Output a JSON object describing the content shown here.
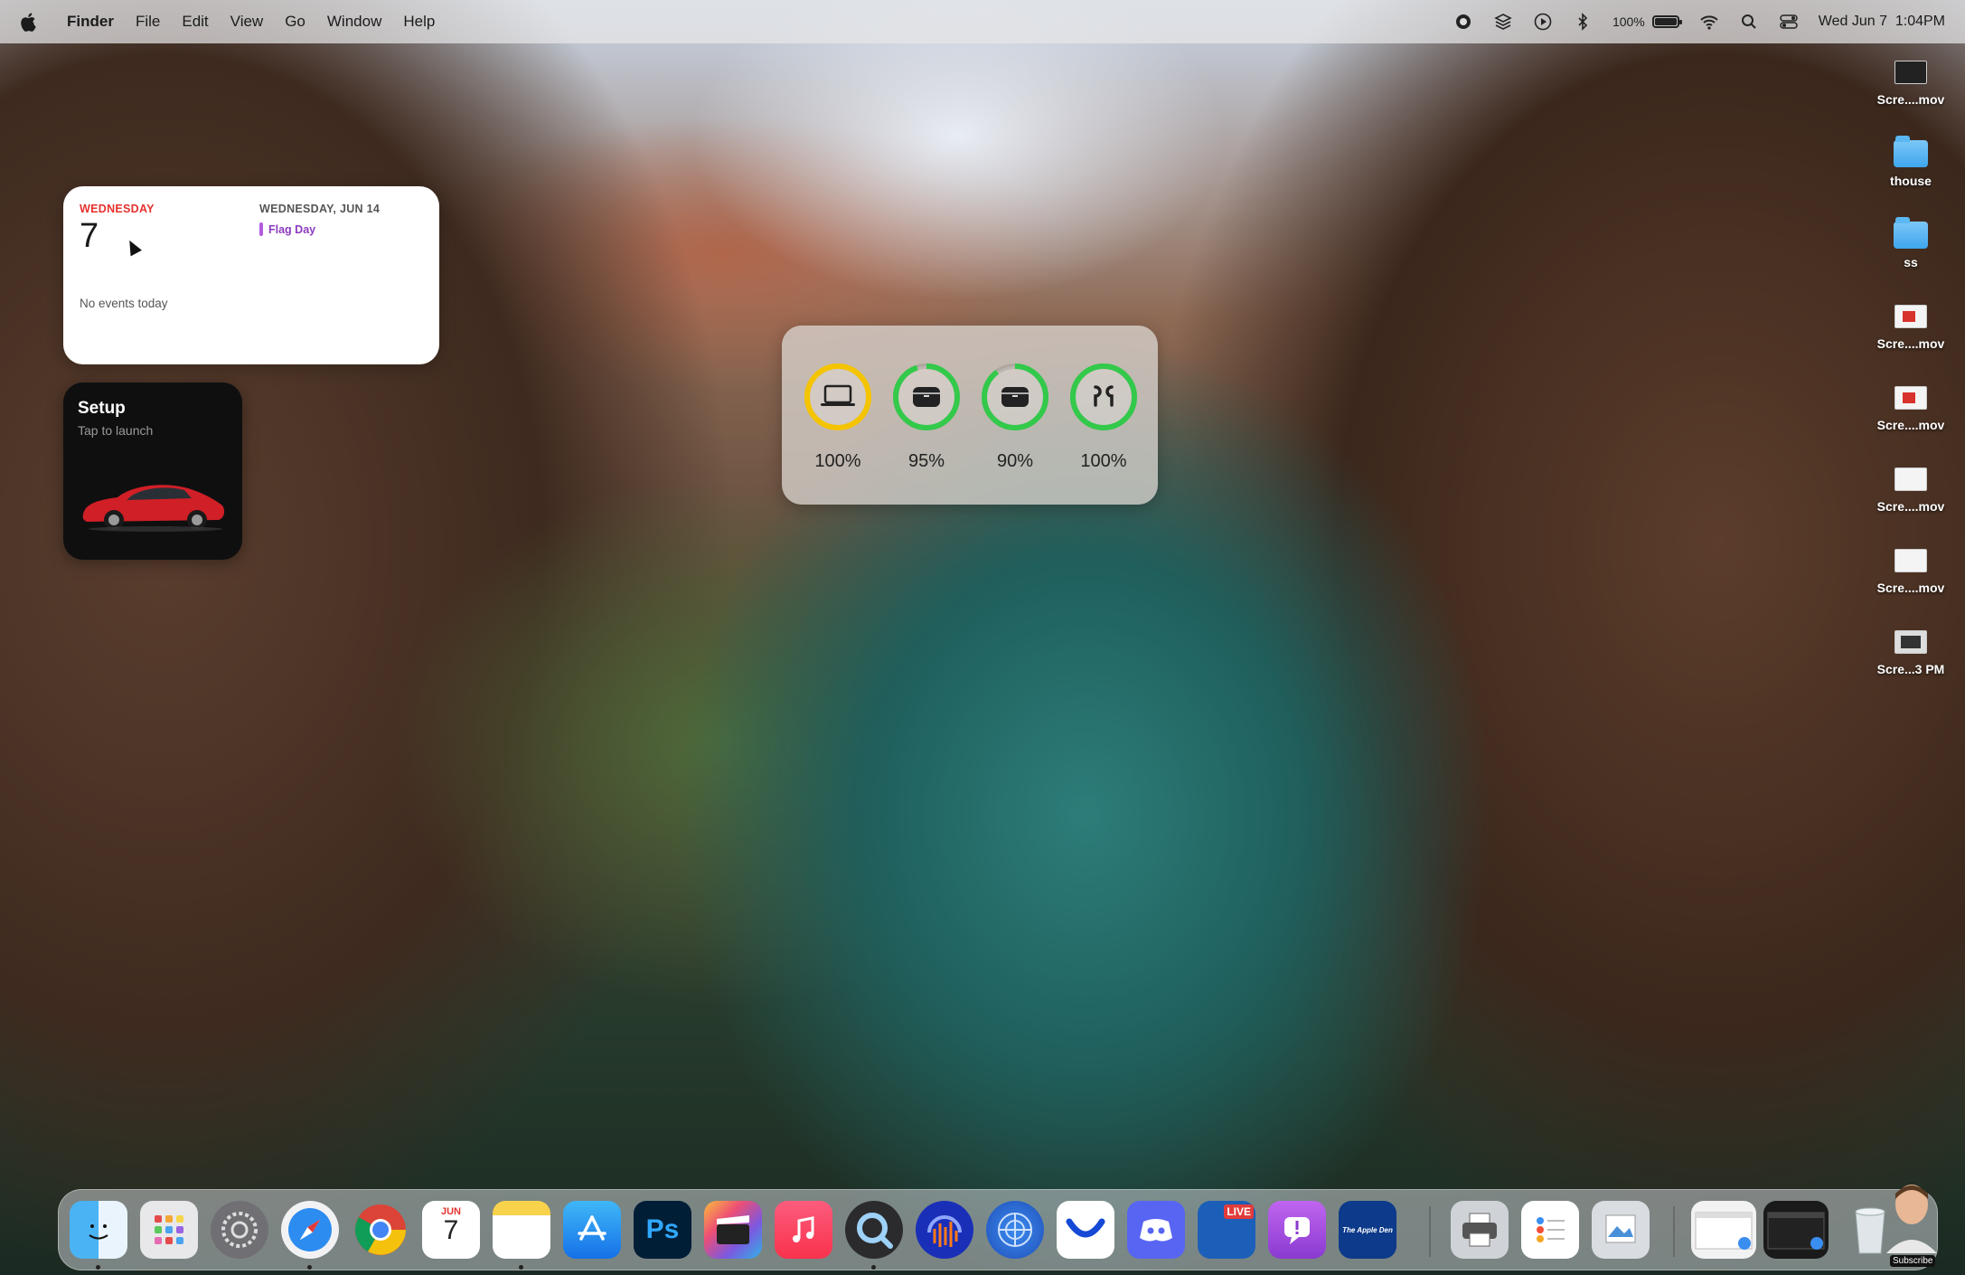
{
  "menubar": {
    "apple_icon": "apple-logo",
    "app_name": "Finder",
    "menus": [
      "File",
      "Edit",
      "View",
      "Go",
      "Window",
      "Help"
    ],
    "status": {
      "battery_percent": "100%",
      "datetime": "Wed Jun 7  1:04PM"
    }
  },
  "calendar_widget": {
    "day_name": "WEDNESDAY",
    "date_number": "7",
    "upcoming_header": "WEDNESDAY, JUN 14",
    "upcoming_event": "Flag Day",
    "empty_text": "No events today",
    "event_color": "#b25be0"
  },
  "tesla_widget": {
    "title": "Setup",
    "subtitle": "Tap to launch"
  },
  "battery_widget": {
    "devices": [
      {
        "icon": "laptop-icon",
        "percent": "100%",
        "level": 1.0,
        "color": "#f5c400"
      },
      {
        "icon": "case-icon",
        "percent": "95%",
        "level": 0.95,
        "color": "#33c94a"
      },
      {
        "icon": "case-icon",
        "percent": "90%",
        "level": 0.9,
        "color": "#33c94a"
      },
      {
        "icon": "airpods-icon",
        "percent": "100%",
        "level": 1.0,
        "color": "#33c94a"
      }
    ]
  },
  "desktop_items": [
    {
      "label": "Scre....mov",
      "kind": "video-dark"
    },
    {
      "label": "thouse",
      "kind": "folder"
    },
    {
      "label": "ss",
      "kind": "folder"
    },
    {
      "label": "Scre....mov",
      "kind": "video-red"
    },
    {
      "label": "Scre....mov",
      "kind": "video-red"
    },
    {
      "label": "Scre....mov",
      "kind": "video-light"
    },
    {
      "label": "Scre....mov",
      "kind": "video-light"
    },
    {
      "label": "Scre...3 PM",
      "kind": "image"
    }
  ],
  "dock": {
    "calendar_month": "JUN",
    "calendar_day": "7",
    "ps_label": "Ps",
    "live_label": "LIVE",
    "apple_den_label": "The Apple Den",
    "subscribe_label": "Subscribe"
  }
}
